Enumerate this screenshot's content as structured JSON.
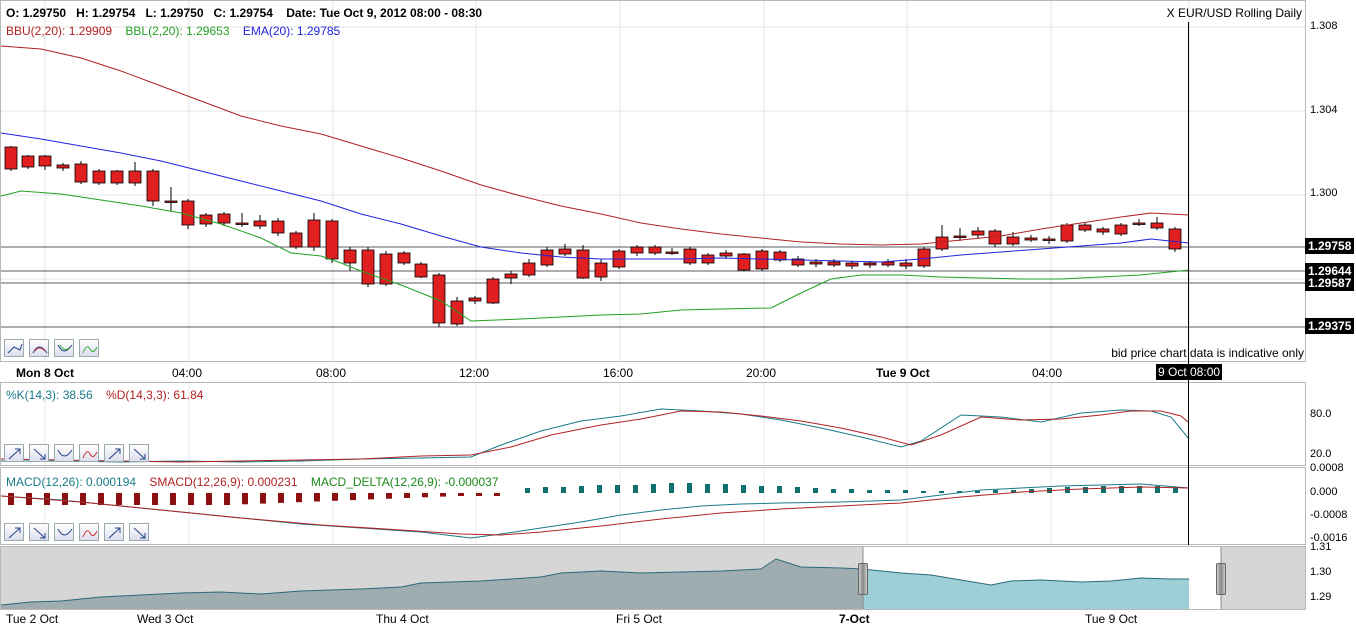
{
  "header": {
    "ohlc": {
      "o": "O: 1.29750",
      "h": "H: 1.29754",
      "l": "L: 1.29750",
      "c": "C: 1.29754",
      "date": "Date: Tue Oct 9, 2012 08:00 - 08:30"
    },
    "symbol_title": "X EUR/USD Rolling Daily",
    "indicators": {
      "bbu": "BBU(2,20): 1.29909",
      "bbl": "BBL(2,20): 1.29653",
      "ema": "EMA(20): 1.29785"
    },
    "colors": {
      "bbu": "#b22222",
      "bbl": "#22a022",
      "ema": "#2222dd",
      "up": "#1a7a1a",
      "down": "#e02020"
    }
  },
  "main_chart": {
    "y_ticks": [
      "1.308",
      "1.304",
      "1.300"
    ],
    "price_boxes": [
      "1.29758",
      "1.29644",
      "1.29587",
      "1.29375"
    ],
    "notice": "bid price chart data is indicative only",
    "x_labels": [
      "Mon 8 Oct",
      "04:00",
      "08:00",
      "12:00",
      "16:00",
      "20:00",
      "Tue 9 Oct",
      "04:00"
    ],
    "cursor_label": "9 Oct 08:00"
  },
  "stochastic": {
    "k": "%K(14,3): 38.56",
    "d": "%D(14,3,3): 61.84",
    "y_ticks": [
      "80.0",
      "20.0"
    ]
  },
  "macd": {
    "macd": "MACD(12,26): 0.000194",
    "smacd": "SMACD(12,26,9): 0.000231",
    "delta": "MACD_DELTA(12,26,9): -0.000037",
    "y_ticks": [
      "0.0008",
      "0.000",
      "-0.0008",
      "-0.0016"
    ]
  },
  "navigator": {
    "y_ticks": [
      "1.31",
      "1.30",
      "1.29"
    ],
    "x_labels": [
      "Tue 2 Oct",
      "Wed 3 Oct",
      "Thu 4 Oct",
      "Fri 5 Oct",
      "7-Oct",
      "Tue 9 Oct"
    ]
  },
  "toolbars": {
    "main": [
      "line-up-icon",
      "curve-up-icon",
      "curve-down-icon",
      "wave-icon"
    ],
    "stoch": [
      "arrow-up-right-icon",
      "arrow-down-right-icon",
      "curve-down-icon",
      "wave-icon",
      "arrow-up-right-icon",
      "arrow-down-right-icon"
    ],
    "macd": [
      "arrow-up-right-icon",
      "arrow-down-right-icon",
      "curve-down-icon",
      "wave-icon",
      "arrow-up-right-icon",
      "arrow-down-right-icon"
    ]
  }
}
